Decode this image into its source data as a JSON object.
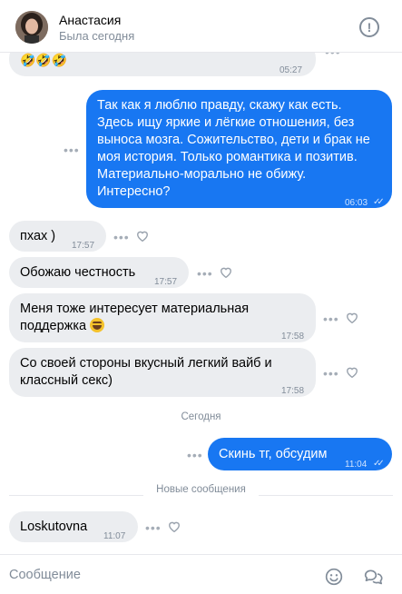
{
  "header": {
    "name": "Анастасия",
    "status": "Была сегодня",
    "info_glyph": "!"
  },
  "messages": [
    {
      "text": "🤣🤣🤣",
      "time": "05:27",
      "direction": "in"
    },
    {
      "text": "Так как я люблю правду, скажу как есть. Здесь ищу яркие и лёгкие отношения, без выноса мозга. Сожительство, дети и брак не моя история. Только романтика и позитив. Материально-морально не обижу. Интересно?",
      "time": "06:03",
      "direction": "out",
      "read": true
    },
    {
      "text": "пхах )",
      "time": "17:57",
      "direction": "in"
    },
    {
      "text": "Обожаю честность",
      "time": "17:57",
      "direction": "in"
    },
    {
      "text": "Меня тоже интересует материальная поддержка",
      "time": "17:58",
      "direction": "in",
      "emoji": "grinning-face"
    },
    {
      "text": "Со своей стороны вкусный легкий вайб и классный секс)",
      "time": "17:58",
      "direction": "in"
    },
    {
      "text": "Скинь тг, обсудим",
      "time": "11:04",
      "direction": "out",
      "read": true
    },
    {
      "text": "Loskutovna",
      "time": "11:07",
      "direction": "in"
    }
  ],
  "separators": {
    "today": "Сегодня",
    "new_messages": "Новые сообщения"
  },
  "composer": {
    "placeholder": "Сообщение"
  },
  "icons": {
    "more": "more-dots-icon",
    "like": "heart-icon",
    "emoji": "smile-icon",
    "templates": "chat-bubbles-icon",
    "read": "double-check-icon"
  },
  "colors": {
    "outgoing_bubble": "#1877f2",
    "incoming_bubble": "#ebedf0",
    "secondary_text": "#818c99"
  }
}
